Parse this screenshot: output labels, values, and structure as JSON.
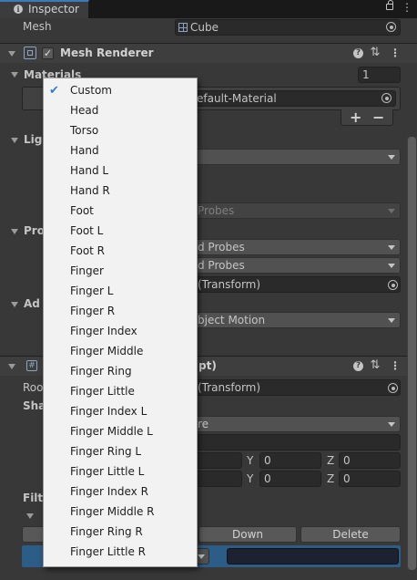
{
  "tab": {
    "title": "Inspector"
  },
  "mesh_field": {
    "label": "Mesh",
    "value": "Cube"
  },
  "mesh_renderer": {
    "title": "Mesh Renderer",
    "materials": {
      "label": "Materials",
      "size": "1",
      "element_value": "efault-Material",
      "plus": "+",
      "minus": "−"
    },
    "lighting_label": "Lig",
    "light_probes_partial": "Probes",
    "probes_label": "Pro",
    "probes_dropdown_1": "d Probes",
    "probes_dropdown_2": "d Probes",
    "anchor_override": "(Transform)",
    "additional_label": "Ad",
    "motion_vectors": "bject Motion"
  },
  "script_component": {
    "title_partial": "pt)",
    "root_label": "Roo",
    "root_value": "(Transform)",
    "shape_label": "Sha",
    "shape_value": "re",
    "y_label_1": "Y",
    "y_value_1": "0",
    "z_label_1": "Z",
    "z_value_1": "0",
    "y_label_2": "Y",
    "y_value_2": "0",
    "z_label_2": "Z",
    "z_value_2": "0",
    "filter_label": "Filt",
    "down_button": "Down",
    "delete_button": "Delete"
  },
  "popup_menu": {
    "selected": "Custom",
    "items": [
      "Custom",
      "Head",
      "Torso",
      "Hand",
      "Hand L",
      "Hand R",
      "Foot",
      "Foot L",
      "Foot R",
      "Finger",
      "Finger L",
      "Finger R",
      "Finger Index",
      "Finger Middle",
      "Finger Ring",
      "Finger Little",
      "Finger Index L",
      "Finger Middle L",
      "Finger Ring L",
      "Finger Little L",
      "Finger Index R",
      "Finger Middle R",
      "Finger Ring R",
      "Finger Little R"
    ]
  },
  "icons": {
    "info": "info-icon",
    "lock": "lock-icon",
    "menu": "kebab-menu-icon",
    "help": "help-icon",
    "preset": "preset-icon",
    "check": "checkmark-icon",
    "target": "object-picker-icon",
    "mesh": "mesh-icon"
  },
  "colors": {
    "panel_bg": "#383838",
    "header_bg": "#3e3e3e",
    "field_bg": "#2a2a2a",
    "selection_blue": "#2c5d87",
    "popup_bg": "#f2f2f2",
    "check_blue": "#2d7ed1"
  }
}
